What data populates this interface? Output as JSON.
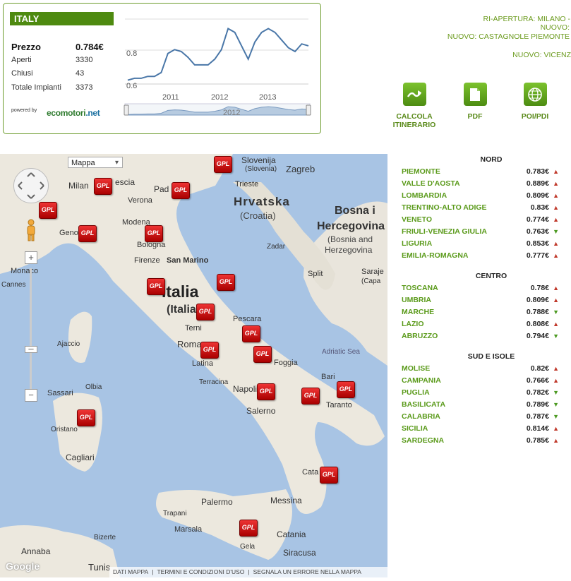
{
  "country": "ITALY",
  "price_label": "Prezzo",
  "price_value": "0.784€",
  "stats": [
    {
      "label": "Aperti",
      "value": "3330"
    },
    {
      "label": "Chiusi",
      "value": "43"
    },
    {
      "label": "Totale Impianti",
      "value": "3373"
    }
  ],
  "powered_by": "powered by",
  "logo_text": {
    "part1": "ecomotori",
    "part2": ".net"
  },
  "mini_chart": {
    "y_ticks": [
      "0.8",
      "0.6"
    ],
    "x_ticks": [
      "2011",
      "2012",
      "2013"
    ],
    "navigator_label": "2012",
    "series": [
      0.58,
      0.59,
      0.59,
      0.6,
      0.6,
      0.62,
      0.72,
      0.74,
      0.73,
      0.7,
      0.66,
      0.66,
      0.66,
      0.69,
      0.74,
      0.85,
      0.83,
      0.76,
      0.69,
      0.78,
      0.83,
      0.85,
      0.83,
      0.79,
      0.75,
      0.73,
      0.77,
      0.76
    ]
  },
  "news": [
    "RI-APERTURA: MILANO -",
    "NUOVO:",
    "NUOVO: CASTAGNOLE PIEMONTE",
    "NUOVO: VICENZ"
  ],
  "tools": [
    {
      "label": "CALCOLA ITINERARIO",
      "icon": "route-icon"
    },
    {
      "label": "PDF",
      "icon": "pdf-icon"
    },
    {
      "label": "POI/PDI",
      "icon": "globe-icon"
    }
  ],
  "map": {
    "type_select": "Mappa",
    "gpl_label": "GPL",
    "labels": {
      "italia": "Italia",
      "italia2": "(Italia)",
      "milan": "Milan",
      "verona": "Verona",
      "modena": "Modena",
      "bologna": "Bologna",
      "genoa": "Genoa",
      "firenze": "Firenze",
      "sanmarino": "San Marino",
      "terni": "Terni",
      "roma": "Roma",
      "latina": "Latina",
      "terracina": "Terracina",
      "pescara": "Pescara",
      "foggia": "Foggia",
      "bari": "Bari",
      "taranto": "Taranto",
      "napoli": "Napoli",
      "salerno": "Salerno",
      "sassari": "Sassari",
      "olbia": "Olbia",
      "oristano": "Oristano",
      "cagliari": "Cagliari",
      "ajaccio": "Ajaccio",
      "palermo": "Palermo",
      "messina": "Messina",
      "catania": "Catania",
      "trapani": "Trapani",
      "marsala": "Marsala",
      "gela": "Gela",
      "siracusa": "Siracusa",
      "monaco": "Monaco",
      "cannes": "Cannes",
      "slovenija": "Slovenija",
      "slovenija2": "(Slovenia)",
      "zagreb": "Zagreb",
      "trieste": "Trieste",
      "hrvatska": "Hrvatska",
      "croatia": "(Croatia)",
      "bosna": "Bosna i",
      "hercegovina": "Hercegovina",
      "bosna2": "(Bosnia and",
      "herzegovina": "Herzegovina",
      "zadar": "Zadar",
      "split": "Split",
      "adriatic": "Adriatic Sea",
      "annaba": "Annaba",
      "bizerte": "Bizerte",
      "tunis": "Tunis",
      "catanzaro": "Cata",
      "sarajevo": "Saraje",
      "sarajevo2": "(Capa",
      "pad": "Pad",
      "escia": "escia"
    },
    "footer": [
      "DATI MAPPA",
      "TERMINI E CONDIZIONI D'USO",
      "SEGNALA UN ERRORE NELLA MAPPA"
    ],
    "google": "Google"
  },
  "regions": [
    {
      "title": "NORD",
      "items": [
        {
          "name": "PIEMONTE",
          "price": "0.783€",
          "trend": "up"
        },
        {
          "name": "VALLE D'AOSTA",
          "price": "0.889€",
          "trend": "up"
        },
        {
          "name": "LOMBARDIA",
          "price": "0.809€",
          "trend": "up"
        },
        {
          "name": "TRENTINO-ALTO ADIGE",
          "price": "0.83€",
          "trend": "up"
        },
        {
          "name": "VENETO",
          "price": "0.774€",
          "trend": "up"
        },
        {
          "name": "FRIULI-VENEZIA GIULIA",
          "price": "0.763€",
          "trend": "down"
        },
        {
          "name": "LIGURIA",
          "price": "0.853€",
          "trend": "up"
        },
        {
          "name": "EMILIA-ROMAGNA",
          "price": "0.777€",
          "trend": "up"
        }
      ]
    },
    {
      "title": "CENTRO",
      "items": [
        {
          "name": "TOSCANA",
          "price": "0.78€",
          "trend": "up"
        },
        {
          "name": "UMBRIA",
          "price": "0.809€",
          "trend": "up"
        },
        {
          "name": "MARCHE",
          "price": "0.788€",
          "trend": "down"
        },
        {
          "name": "LAZIO",
          "price": "0.808€",
          "trend": "up"
        },
        {
          "name": "ABRUZZO",
          "price": "0.794€",
          "trend": "down"
        }
      ]
    },
    {
      "title": "SUD E ISOLE",
      "items": [
        {
          "name": "MOLISE",
          "price": "0.82€",
          "trend": "up"
        },
        {
          "name": "CAMPANIA",
          "price": "0.766€",
          "trend": "up"
        },
        {
          "name": "PUGLIA",
          "price": "0.782€",
          "trend": "down"
        },
        {
          "name": "BASILICATA",
          "price": "0.789€",
          "trend": "down"
        },
        {
          "name": "CALABRIA",
          "price": "0.787€",
          "trend": "down"
        },
        {
          "name": "SICILIA",
          "price": "0.814€",
          "trend": "up"
        },
        {
          "name": "SARDEGNA",
          "price": "0.785€",
          "trend": "up"
        }
      ]
    }
  ]
}
